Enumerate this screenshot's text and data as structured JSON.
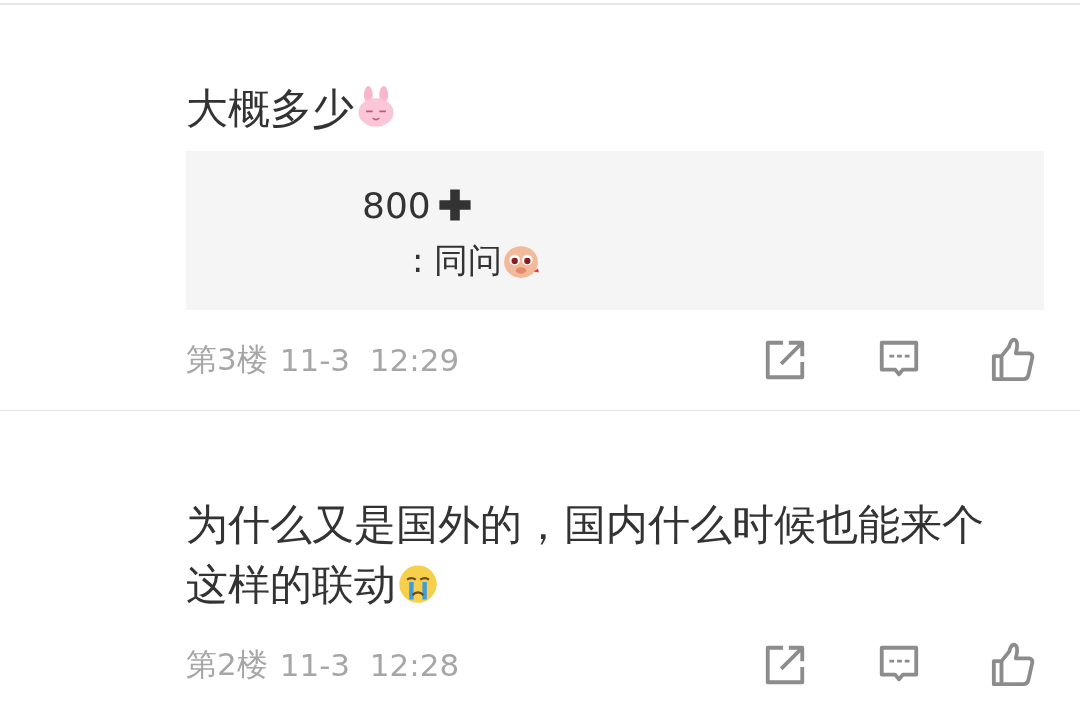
{
  "posts": [
    {
      "text": "大概多少",
      "quote": [
        {
          "text": "800"
        },
        {
          "text": ":  同问"
        }
      ],
      "floor": "第3楼",
      "time": "11-3  12:29"
    },
    {
      "text": "为什么又是国外的，国内什么时候也能来个这样的联动",
      "floor": "第2楼",
      "time": "11-3  12:28"
    }
  ]
}
